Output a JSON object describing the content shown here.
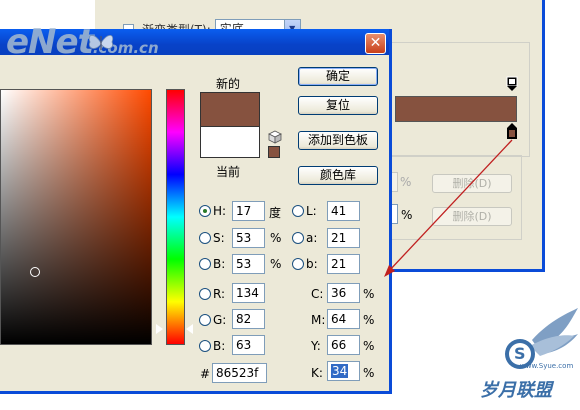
{
  "background_window": {
    "title_label": "渐变类型(T):",
    "type_value": "实底",
    "pct_symbol_1": "%",
    "pct_symbol_2": "%",
    "delete_button_1": "删除(D)",
    "delete_button_2": "删除(D)"
  },
  "watermark": {
    "brand": "eNet",
    "domain": ".com.cn"
  },
  "color_picker": {
    "close_glyph": "✕",
    "new_label": "新的",
    "current_label": "当前",
    "buttons": {
      "ok": "确定",
      "reset": "复位",
      "add_to_swatches": "添加到色板",
      "color_libraries": "颜色库"
    },
    "hsb": {
      "h": {
        "label": "H:",
        "value": "17",
        "unit": "度"
      },
      "s": {
        "label": "S:",
        "value": "53",
        "unit": "%"
      },
      "b": {
        "label": "B:",
        "value": "53",
        "unit": "%"
      }
    },
    "lab": {
      "l": {
        "label": "L:",
        "value": "41"
      },
      "a": {
        "label": "a:",
        "value": "21"
      },
      "b": {
        "label": "b:",
        "value": "21"
      }
    },
    "rgb": {
      "r": {
        "label": "R:",
        "value": "134"
      },
      "g": {
        "label": "G:",
        "value": "82"
      },
      "b": {
        "label": "B:",
        "value": "63"
      }
    },
    "cmyk": {
      "c": {
        "label": "C:",
        "value": "36",
        "unit": "%"
      },
      "m": {
        "label": "M:",
        "value": "64",
        "unit": "%"
      },
      "y": {
        "label": "Y:",
        "value": "66",
        "unit": "%"
      },
      "k": {
        "label": "K:",
        "value": "34",
        "unit": "%"
      }
    },
    "hex": {
      "label": "#",
      "value": "86523f"
    },
    "selected_color": "#86523f",
    "selected_radio": "H"
  },
  "logo": {
    "letter": "S",
    "site": "www.Syue.com",
    "name": "岁月联盟"
  },
  "colors": {
    "xp_blue": "#0a4bd8",
    "selected_color": "#86523f",
    "arrow_red": "#c02020"
  }
}
